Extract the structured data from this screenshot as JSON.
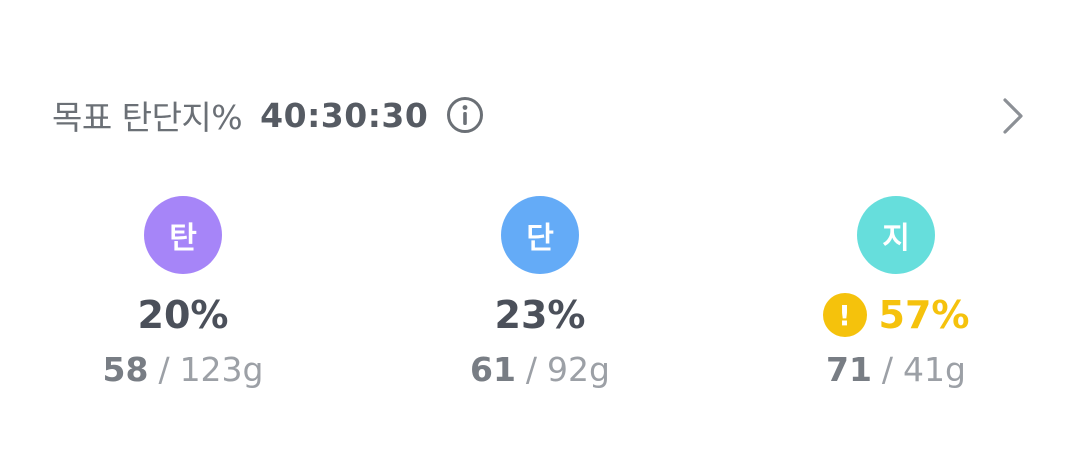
{
  "header": {
    "label": "목표 탄단지%",
    "ratio": "40:30:30"
  },
  "colors": {
    "carb": "#a685f8",
    "protein": "#64abf7",
    "fat": "#66dedc",
    "warning": "#f5c20c"
  },
  "macros": [
    {
      "badge": "탄",
      "percent": "20%",
      "actual": "58",
      "separator": "/",
      "target": "123g",
      "warning": false
    },
    {
      "badge": "단",
      "percent": "23%",
      "actual": "61",
      "separator": "/",
      "target": "92g",
      "warning": false
    },
    {
      "badge": "지",
      "percent": "57%",
      "actual": "71",
      "separator": "/",
      "target": "41g",
      "warning": true,
      "warning_symbol": "!"
    }
  ]
}
